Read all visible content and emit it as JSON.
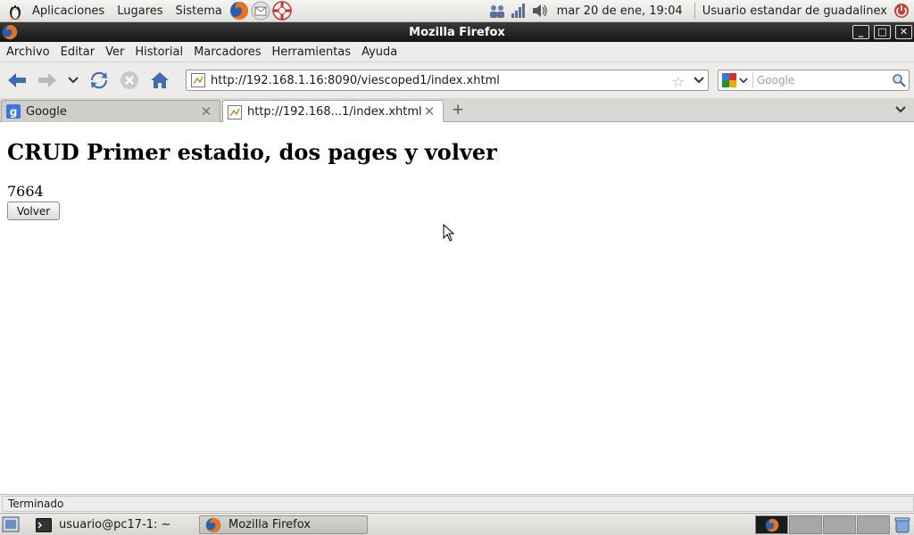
{
  "top_panel": {
    "menus": [
      "Aplicaciones",
      "Lugares",
      "Sistema"
    ],
    "clock": "mar 20 de ene, 19:04",
    "user": "Usuario estandar de guadalinex"
  },
  "window": {
    "title": "Mozilla Firefox"
  },
  "menubar": {
    "items": [
      "Archivo",
      "Editar",
      "Ver",
      "Historial",
      "Marcadores",
      "Herramientas",
      "Ayuda"
    ]
  },
  "navbar": {
    "url": "http://192.168.1.16:8090/viescoped1/index.xhtml",
    "search_placeholder": "Google"
  },
  "tabs": [
    {
      "label": "Google"
    },
    {
      "label": "http://192.168...1/index.xhtml"
    }
  ],
  "page": {
    "heading": "CRUD Primer estadio, dos pages y volver",
    "value": "7664",
    "button_label": "Volver"
  },
  "status": {
    "text": "Terminado"
  },
  "taskbar": {
    "items": [
      {
        "label": "usuario@pc17-1: ~"
      },
      {
        "label": "Mozilla Firefox"
      }
    ]
  },
  "colors": {
    "accent": "#4a90d9",
    "titlebar": "#1a1a1a"
  }
}
